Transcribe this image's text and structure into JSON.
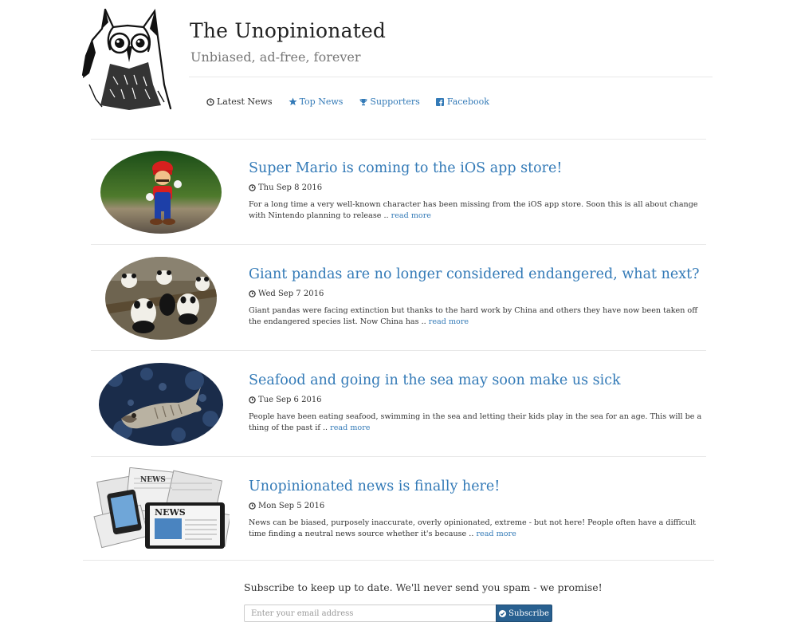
{
  "site": {
    "title": "The Unopinionated",
    "tagline": "Unbiased, ad-free, forever"
  },
  "nav": [
    {
      "label": "Latest News",
      "icon": "clock-icon",
      "active": true
    },
    {
      "label": "Top News",
      "icon": "star-icon",
      "active": false
    },
    {
      "label": "Supporters",
      "icon": "trophy-icon",
      "active": false
    },
    {
      "label": "Facebook",
      "icon": "facebook-icon",
      "active": false
    }
  ],
  "articles": [
    {
      "title": "Super Mario is coming to the iOS app store!",
      "date": "Thu Sep 8 2016",
      "summary": "For a long time a very well-known character has been missing from the iOS app store. Soon this is all about change with Nintendo planning to release ..",
      "read_more": "read more",
      "image": "mario-figure-image"
    },
    {
      "title": "Giant pandas are no longer considered endangered, what next?",
      "date": "Wed Sep 7 2016",
      "summary": "Giant pandas were facing extinction but thanks to the hard work by China and others they have now been taken off the endangered species list. Now China has ..",
      "read_more": "read more",
      "image": "pandas-image"
    },
    {
      "title": "Seafood and going in the sea may soon make us sick",
      "date": "Tue Sep 6 2016",
      "summary": "People have been eating seafood, swimming in the sea and letting their kids play in the sea for an age. This will be a thing of the past if ..",
      "read_more": "read more",
      "image": "dead-fish-image"
    },
    {
      "title": "Unopinionated news is finally here!",
      "date": "Mon Sep 5 2016",
      "summary": "News can be biased, purposely inaccurate, overly opinionated, extreme - but not here! People often have a difficult time finding a neutral news source whether it's because ..",
      "read_more": "read more",
      "image": "newspapers-devices-image"
    }
  ],
  "subscribe": {
    "text": "Subscribe to keep up to date. We'll never send you spam - we promise!",
    "placeholder": "Enter your email address",
    "button_label": "Subscribe"
  },
  "colors": {
    "link": "#337ab7",
    "button": "#286090"
  }
}
